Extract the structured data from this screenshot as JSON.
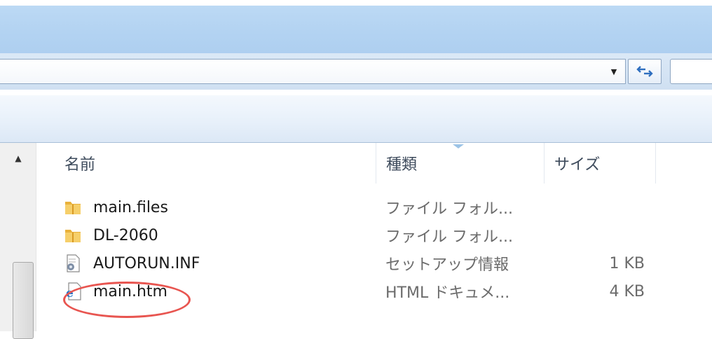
{
  "window": {
    "title_bar": ""
  },
  "address_bar": {
    "dropdown_icon": "dropdown-arrow-icon",
    "refresh_icon": "refresh-icon",
    "search_placeholder": ""
  },
  "columns": {
    "name": "名前",
    "type": "種類",
    "size": "サイズ"
  },
  "files": [
    {
      "name": "main.files",
      "type": "ファイル フォル...",
      "size": "",
      "icon": "folder-icon"
    },
    {
      "name": "DL-2060",
      "type": "ファイル フォル...",
      "size": "",
      "icon": "folder-icon"
    },
    {
      "name": "AUTORUN.INF",
      "type": "セットアップ情報",
      "size": "1 KB",
      "icon": "setup-info-icon"
    },
    {
      "name": "main.htm",
      "type": "HTML ドキュメ...",
      "size": "4 KB",
      "icon": "ie-html-icon"
    }
  ],
  "highlight": {
    "target": "main.htm",
    "color": "#e85550"
  }
}
